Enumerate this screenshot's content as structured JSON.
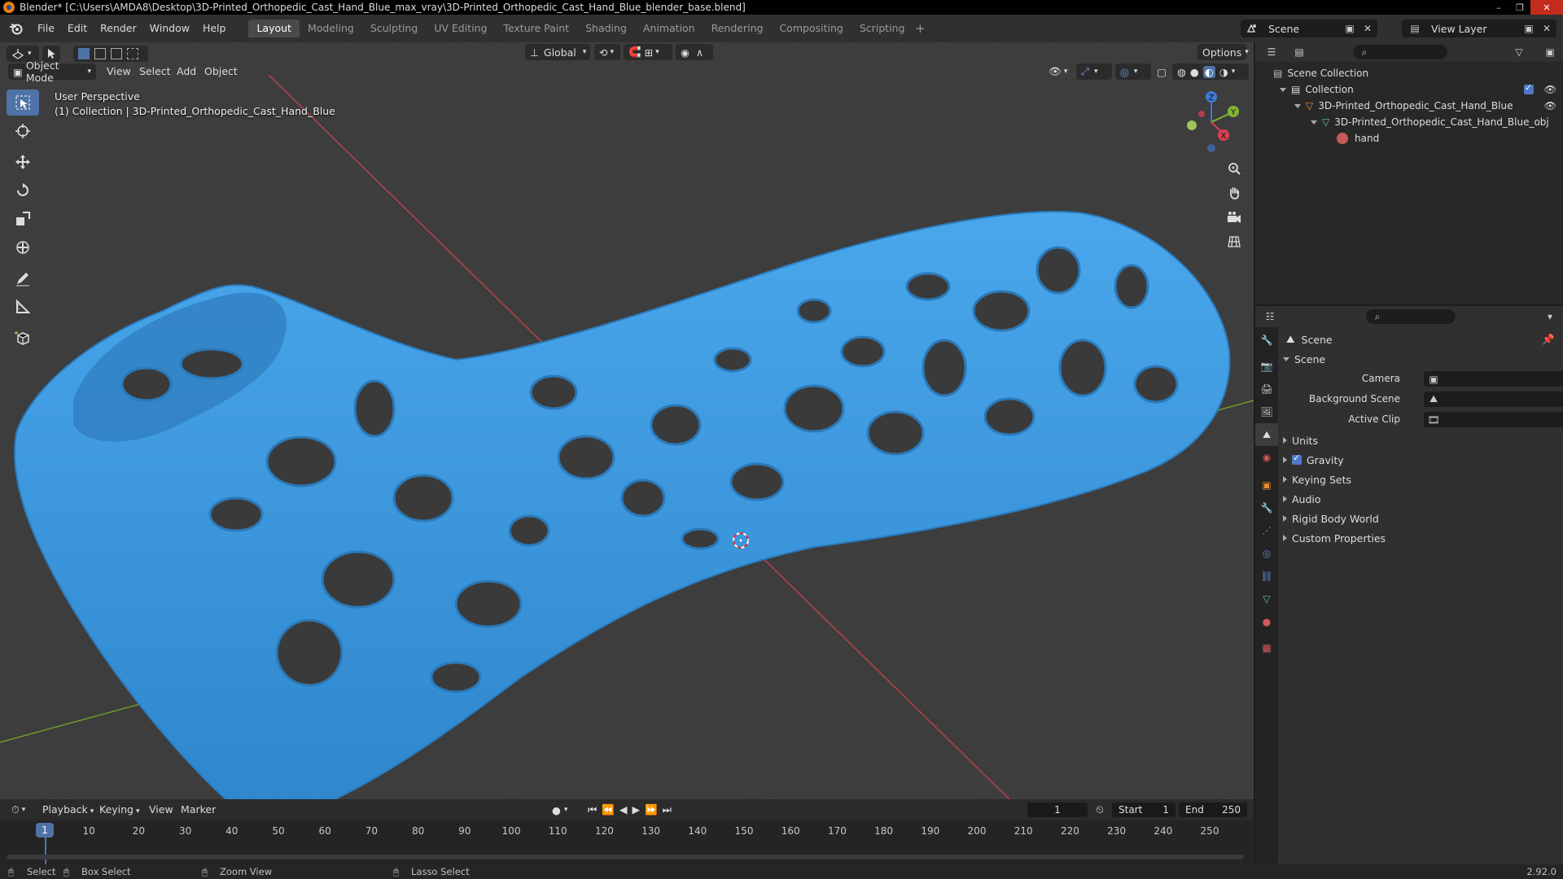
{
  "window": {
    "title": "Blender* [C:\\Users\\AMDA8\\Desktop\\3D-Printed_Orthopedic_Cast_Hand_Blue_max_vray\\3D-Printed_Orthopedic_Cast_Hand_Blue_blender_base.blend]"
  },
  "menu": [
    "File",
    "Edit",
    "Render",
    "Window",
    "Help"
  ],
  "workspaces": [
    "Layout",
    "Modeling",
    "Sculpting",
    "UV Editing",
    "Texture Paint",
    "Shading",
    "Animation",
    "Rendering",
    "Compositing",
    "Scripting"
  ],
  "active_workspace": "Layout",
  "scene_selector": "Scene",
  "view_layer": "View Layer",
  "viewport": {
    "mode": "Object Mode",
    "menus": [
      "View",
      "Select",
      "Add",
      "Object"
    ],
    "transform_orientation": "Global",
    "options_label": "Options",
    "info_line1": "User Perspective",
    "info_line2": "(1) Collection | 3D-Printed_Orthopedic_Cast_Hand_Blue",
    "gizmo_axes": [
      "X",
      "Y",
      "Z"
    ]
  },
  "timeline": {
    "menus": [
      "Playback",
      "Keying",
      "View",
      "Marker"
    ],
    "current_frame": "1",
    "start_label": "Start",
    "start_value": "1",
    "end_label": "End",
    "end_value": "250",
    "ruler_ticks": [
      "10",
      "20",
      "30",
      "40",
      "50",
      "60",
      "70",
      "80",
      "90",
      "100",
      "110",
      "120",
      "130",
      "140",
      "150",
      "160",
      "170",
      "180",
      "190",
      "200",
      "210",
      "220",
      "230",
      "240",
      "250"
    ],
    "playhead": "1"
  },
  "statusbar": {
    "select": "Select",
    "box_select": "Box Select",
    "zoom_view": "Zoom View",
    "lasso_select": "Lasso Select",
    "version": "2.92.0"
  },
  "outliner": {
    "items": [
      {
        "label": "Scene Collection",
        "depth": 0
      },
      {
        "label": "Collection",
        "depth": 1
      },
      {
        "label": "3D-Printed_Orthopedic_Cast_Hand_Blue",
        "depth": 2
      },
      {
        "label": "3D-Printed_Orthopedic_Cast_Hand_Blue_obj",
        "depth": 3
      },
      {
        "label": "hand",
        "depth": 4
      }
    ]
  },
  "properties": {
    "context": "Scene",
    "panel_title": "Scene",
    "fields": [
      {
        "label": "Camera"
      },
      {
        "label": "Background Scene"
      },
      {
        "label": "Active Clip"
      }
    ],
    "subpanels": [
      "Units",
      "Gravity",
      "Keying Sets",
      "Audio",
      "Rigid Body World",
      "Custom Properties"
    ]
  },
  "colors": {
    "accent": "#4f73a8",
    "cast": "#3d9be0",
    "x_axis": "#d64050",
    "y_axis": "#82b431",
    "z_axis": "#3f7ad6"
  }
}
